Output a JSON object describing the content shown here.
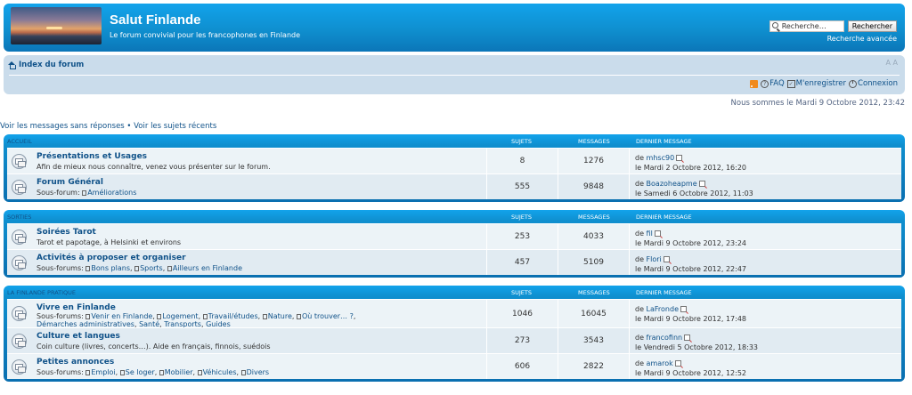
{
  "header": {
    "site_title": "Salut Finlande",
    "site_desc": "Le forum convivial pour les francophones en Finlande",
    "search_placeholder": "Recherche…",
    "search_button": "Rechercher",
    "advanced_search": "Recherche avancée"
  },
  "nav": {
    "home": "Index du forum",
    "font_resize": "A A",
    "faq": "FAQ",
    "register": "M'enregistrer",
    "login": "Connexion",
    "date": "Nous sommes le Mardi 9 Octobre 2012, 23:42"
  },
  "quick_links": {
    "unanswered": "Voir les messages sans réponses",
    "sep": " • ",
    "recent": "Voir les sujets récents"
  },
  "columns": {
    "topics": "SUJETS",
    "posts": "MESSAGES",
    "last": "DERNIER MESSAGE"
  },
  "categories": [
    {
      "name": "ACCUEIL",
      "forums": [
        {
          "title": "Présentations et Usages",
          "desc": "Afin de mieux nous connaître, venez vous présenter sur le forum.",
          "topics": "8",
          "posts": "1276",
          "by": "de ",
          "last_user": "mhsc90",
          "last_date": "le Mardi 2 Octobre 2012, 16:20"
        },
        {
          "title": "Forum Général",
          "sub_label": "Sous-forum:",
          "subs": [
            "Améliorations"
          ],
          "topics": "555",
          "posts": "9848",
          "by": "de ",
          "last_user": "Boazoheapme",
          "last_date": "le Samedi 6 Octobre 2012, 11:03"
        }
      ]
    },
    {
      "name": "SORTIES",
      "forums": [
        {
          "title": "Soirées Tarot",
          "desc": "Tarot et papotage, à Helsinki et environs",
          "topics": "253",
          "posts": "4033",
          "by": "de ",
          "last_user": "fil",
          "last_date": "le Mardi 9 Octobre 2012, 23:24"
        },
        {
          "title": "Activités à proposer et organiser",
          "sub_label": "Sous-forums:",
          "subs": [
            "Bons plans",
            "Sports",
            "Ailleurs en Finlande"
          ],
          "topics": "457",
          "posts": "5109",
          "by": "de ",
          "last_user": "Flori",
          "last_date": "le Mardi 9 Octobre 2012, 22:47"
        }
      ]
    },
    {
      "name": "LA FINLANDE PRATIQUE",
      "forums": [
        {
          "title": "Vivre en Finlande",
          "sub_label": "Sous-forums:",
          "subs": [
            "Venir en Finlande",
            "Logement",
            "Travail/études",
            "Nature",
            "Où trouver… ?"
          ],
          "subs2": [
            "Démarches administratives",
            "Santé",
            "Transports",
            "Guides"
          ],
          "topics": "1046",
          "posts": "16045",
          "by": "de ",
          "last_user": "LaFronde",
          "last_date": "le Mardi 9 Octobre 2012, 17:48"
        },
        {
          "title": "Culture et langues",
          "desc": "Coin culture (livres, concerts…). Aide en français, finnois, suédois",
          "topics": "273",
          "posts": "3543",
          "by": "de ",
          "last_user": "francofinn",
          "last_date": "le Vendredi 5 Octobre 2012, 18:33"
        },
        {
          "title": "Petites annonces",
          "sub_label": "Sous-forums:",
          "subs": [
            "Emploi",
            "Se loger",
            "Mobilier",
            "Véhicules",
            "Divers"
          ],
          "topics": "606",
          "posts": "2822",
          "by": "de ",
          "last_user": "amarok",
          "last_date": "le Mardi 9 Octobre 2012, 12:52"
        }
      ]
    }
  ]
}
